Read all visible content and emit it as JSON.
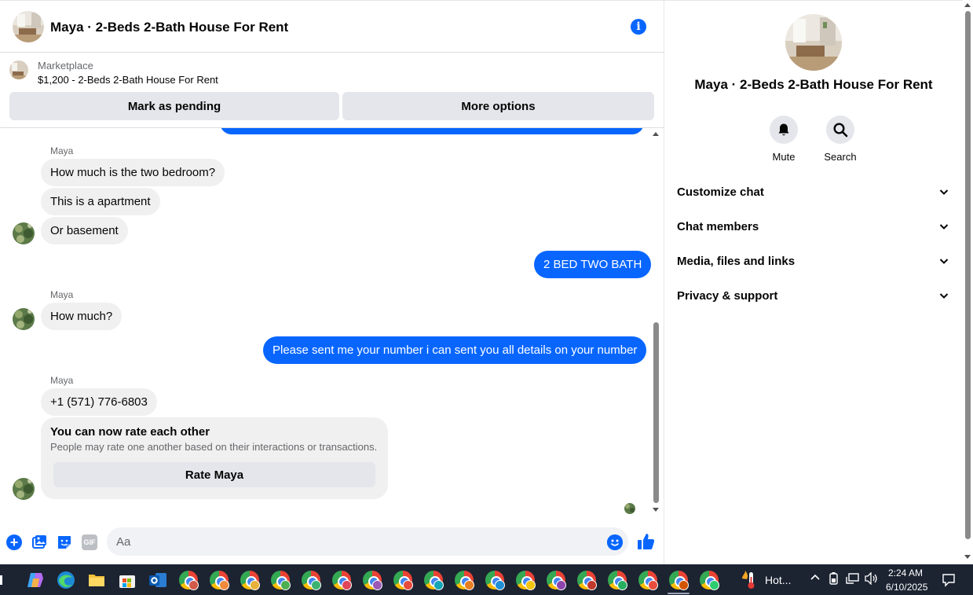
{
  "conversation": {
    "title": "Maya · 2-Beds 2-Bath House For Rent"
  },
  "marketplace": {
    "label": "Marketplace",
    "listing": "$1,200 - 2-Beds 2-Bath House For Rent",
    "pending_button": "Mark as pending",
    "more_button": "More options"
  },
  "messages": {
    "sender_name": "Maya",
    "group1": [
      "How much is the two bedroom?",
      "This is a apartment",
      "Or basement"
    ],
    "out1": "2 BED TWO BATH",
    "group2": [
      "How much?"
    ],
    "out2": "Please sent me your number i can sent you all details on your number",
    "group3": [
      "+1 (571) 776-6803"
    ],
    "rate_card": {
      "title": "You can now rate each other",
      "subtitle": "People may rate one another based on their interactions or transactions.",
      "button": "Rate Maya"
    }
  },
  "composer": {
    "placeholder": "Aa",
    "gif_label": "GIF"
  },
  "info_panel": {
    "title": "Maya · 2-Beds 2-Bath House For Rent",
    "mute_label": "Mute",
    "search_label": "Search",
    "sections": [
      "Customize chat",
      "Chat members",
      "Media, files and links",
      "Privacy & support"
    ]
  },
  "taskbar": {
    "weather": "Hot...",
    "time": "2:24 AM",
    "date": "6/10/2025"
  },
  "colors": {
    "accent": "#0866ff",
    "bubble_in": "#f0f0f0",
    "button_gray": "#e4e6eb",
    "taskbar": "#1c2331"
  }
}
